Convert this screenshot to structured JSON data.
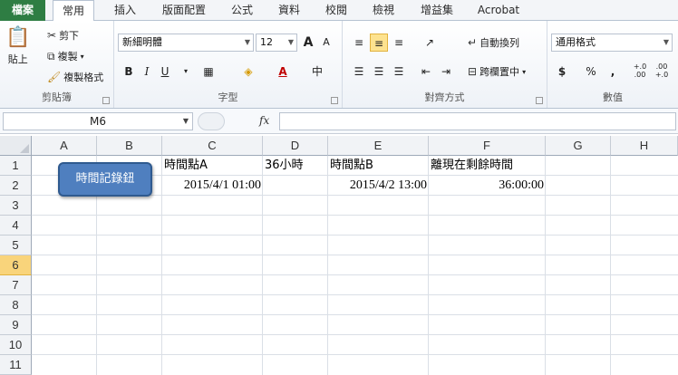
{
  "ribbon_tabs": [
    "檔案",
    "常用",
    "插入",
    "版面配置",
    "公式",
    "資料",
    "校閱",
    "檢視",
    "增益集",
    "Acrobat"
  ],
  "active_tab": "常用",
  "clipboard": {
    "paste": "貼上",
    "cut": "剪下",
    "copy": "複製",
    "format_painter": "複製格式",
    "label": "剪貼簿"
  },
  "font": {
    "name": "新細明體",
    "size": "12",
    "grow": "A",
    "shrink": "A",
    "bold": "B",
    "italic": "I",
    "underline": "U",
    "color_letter": "A",
    "phonetic": "中",
    "label": "字型"
  },
  "alignment": {
    "wrap_text": "自動換列",
    "merge_center": "跨欄置中",
    "label": "對齊方式"
  },
  "number": {
    "format": "通用格式",
    "currency": "$",
    "percent": "%",
    "comma": ",",
    "inc_decimal": "+.0\n.00",
    "dec_decimal": ".00\n+.0",
    "label": "數值"
  },
  "formula_bar": {
    "name_box": "M6",
    "fx": "fx",
    "formula": ""
  },
  "columns": [
    "A",
    "B",
    "C",
    "D",
    "E",
    "F",
    "G",
    "H"
  ],
  "rows": [
    "1",
    "2",
    "3",
    "4",
    "5",
    "6",
    "7",
    "8",
    "9",
    "10",
    "11"
  ],
  "selected_row": "6",
  "cells": {
    "C1": "時間點A",
    "D1": "36小時",
    "E1": "時間點B",
    "F1": "離現在剩餘時間",
    "C2": "2015/4/1 01:00",
    "E2": "2015/4/2 13:00",
    "F2": "36:00:00"
  },
  "shape_button": {
    "label": "時間記錄鈕"
  },
  "colors": {
    "file_tab": "#2e7d43",
    "shape_fill": "#4f7fbf",
    "selected_row": "#f9d47b"
  }
}
